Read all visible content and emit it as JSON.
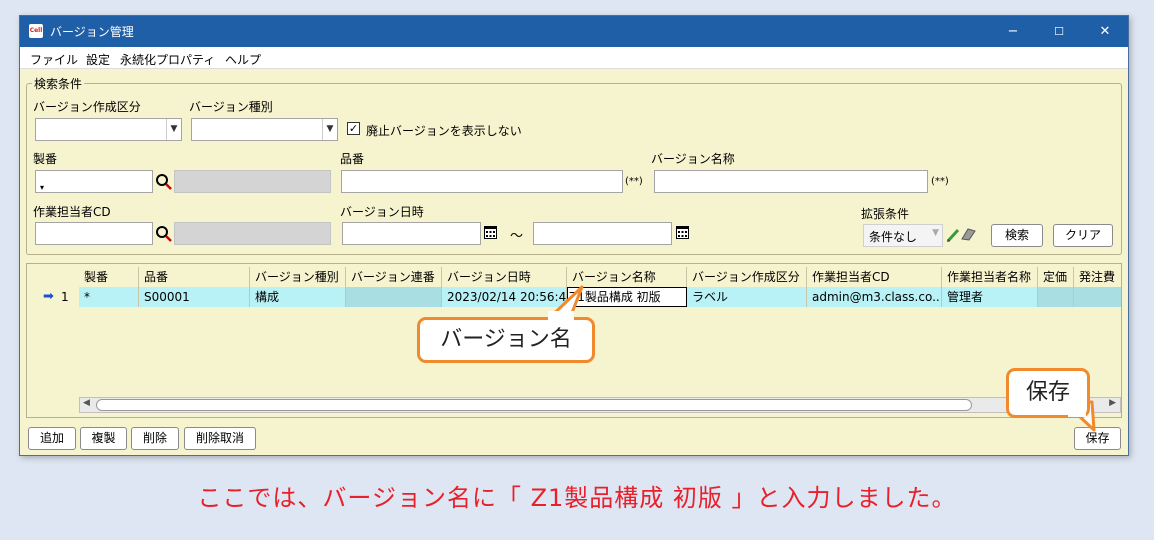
{
  "window": {
    "title": "バージョン管理",
    "app_icon_text": "Cell",
    "minimize": "−",
    "maximize": "☐",
    "close": "✕"
  },
  "menu": [
    "ファイル",
    "設定",
    "永続化プロパティ",
    "ヘルプ"
  ],
  "search": {
    "legend": "検索条件",
    "version_create_type_label": "バージョン作成区分",
    "version_type_label": "バージョン種別",
    "hide_obsolete_checked": true,
    "hide_obsolete_label": "廃止バージョンを表示しない",
    "seiban_label": "製番",
    "hinban_label": "品番",
    "hinban_hint": "(**)",
    "version_name_label": "バージョン名称",
    "version_name_hint": "(**)",
    "worker_cd_label": "作業担当者CD",
    "version_datetime_label": "バージョン日時",
    "tilde": "～",
    "ext_cond_label": "拡張条件",
    "ext_cond_value": "条件なし",
    "search_button": "検索",
    "clear_button": "クリア"
  },
  "table": {
    "headers": [
      "製番",
      "品番",
      "バージョン種別",
      "バージョン連番",
      "バージョン日時",
      "バージョン名称",
      "バージョン作成区分",
      "作業担当者CD",
      "作業担当者名称",
      "定価",
      "発注費"
    ],
    "rows": [
      {
        "marker": "➡",
        "num": "1",
        "cells": [
          "*",
          "S00001",
          "構成",
          "",
          "2023/02/14 20:56:42",
          "Z1製品構成 初版",
          "ラベル",
          "admin@m3.class.co...",
          "管理者",
          "",
          ""
        ]
      }
    ]
  },
  "bottom_buttons": {
    "add": "追加",
    "copy": "複製",
    "delete": "削除",
    "undelete": "削除取消",
    "save": "保存"
  },
  "callouts": {
    "version_name": "バージョン名",
    "save": "保存"
  },
  "caption": "ここでは、バージョン名に「 Z1製品構成 初版 」と入力しました。",
  "colors": {
    "title_bar": "#1f5fa8",
    "panel": "#f6f3cf",
    "selected_row": "#b9f2f6",
    "callout_border": "#f08a2c",
    "caption": "#e8202a"
  }
}
